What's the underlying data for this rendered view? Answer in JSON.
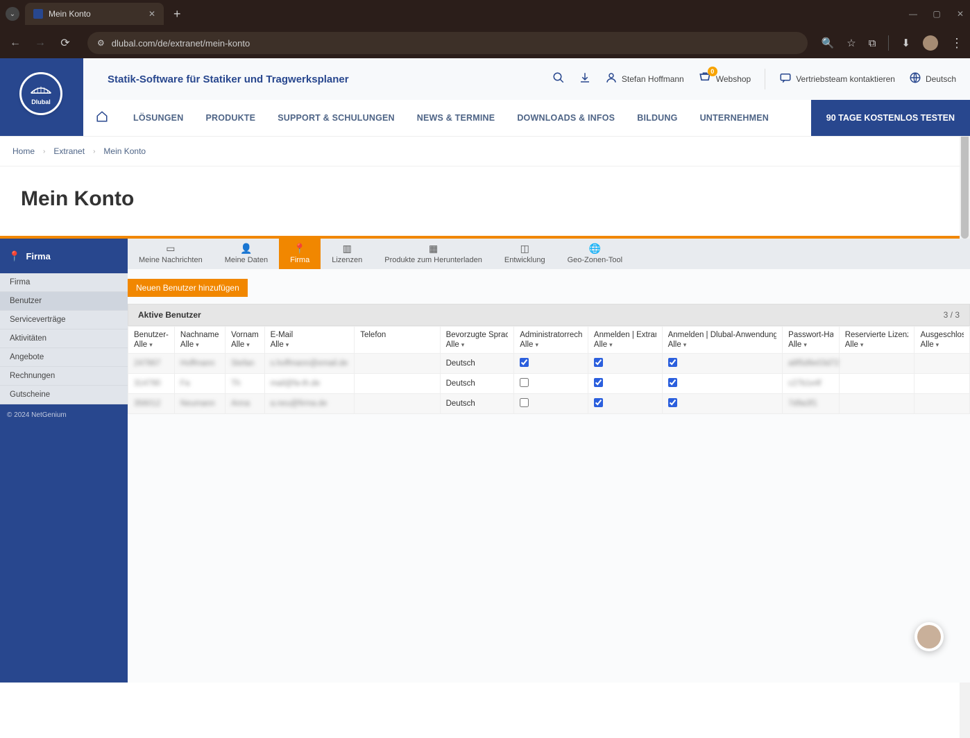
{
  "browser": {
    "tab_title": "Mein Konto",
    "url": "dlubal.com/de/extranet/mein-konto"
  },
  "header": {
    "tagline": "Statik-Software für Statiker und Tragwerksplaner",
    "username": "Stefan Hoffmann",
    "webshop_label": "Webshop",
    "cart_badge": "0",
    "contact_label": "Vertriebsteam kontaktieren",
    "language": "Deutsch",
    "logo_text": "Dlubal"
  },
  "main_nav": {
    "items": [
      "LÖSUNGEN",
      "PRODUKTE",
      "SUPPORT & SCHULUNGEN",
      "NEWS & TERMINE",
      "DOWNLOADS & INFOS",
      "BILDUNG",
      "UNTERNEHMEN"
    ],
    "cta": "90 TAGE KOSTENLOS TESTEN"
  },
  "breadcrumbs": [
    "Home",
    "Extranet",
    "Mein Konto"
  ],
  "page_title": "Mein Konto",
  "sidebar": {
    "top": "Firma",
    "items": [
      "Firma",
      "Benutzer",
      "Serviceverträge",
      "Aktivitäten",
      "Angebote",
      "Rechnungen",
      "Gutscheine"
    ],
    "active_index": 1,
    "copyright": "© 2024 NetGenium"
  },
  "tabs": {
    "items": [
      "Meine Nachrichten",
      "Meine Daten",
      "Firma",
      "Lizenzen",
      "Produkte zum Herunterladen",
      "Entwicklung",
      "Geo-Zonen-Tool"
    ],
    "active_index": 2
  },
  "add_user_button": "Neuen Benutzer hinzufügen",
  "table": {
    "title": "Aktive Benutzer",
    "count": "3 / 3",
    "filter_all": "Alle",
    "columns": [
      "Benutzer-ID",
      "Nachname",
      "Vorname",
      "E-Mail",
      "Telefon",
      "Bevorzugte Sprache",
      "Administratorrechte",
      "Anmelden | Extranet",
      "Anmelden | Dlubal-Anwendungen",
      "Passwort-Hash",
      "Reservierte Lizenzen",
      "Ausgeschlosse"
    ],
    "rows": [
      {
        "user_id": "247867",
        "lastname": "Hoffmann",
        "firstname": "Stefan",
        "email": "s.hoffmann@email.de",
        "phone": "",
        "language": "Deutsch",
        "admin": true,
        "extranet": true,
        "apps": true,
        "hash": "a8f5d9e03d72",
        "reserved": "",
        "excluded": ""
      },
      {
        "user_id": "314790",
        "lastname": "Fa",
        "firstname": "Th",
        "email": "mail@fa-th.de",
        "phone": "",
        "language": "Deutsch",
        "admin": false,
        "extranet": true,
        "apps": true,
        "hash": "c27b1e4f",
        "reserved": "",
        "excluded": ""
      },
      {
        "user_id": "356012",
        "lastname": "Neumann",
        "firstname": "Anna",
        "email": "a.neu@firma.de",
        "phone": "",
        "language": "Deutsch",
        "admin": false,
        "extranet": true,
        "apps": true,
        "hash": "7d9a3f1",
        "reserved": "",
        "excluded": ""
      }
    ]
  }
}
